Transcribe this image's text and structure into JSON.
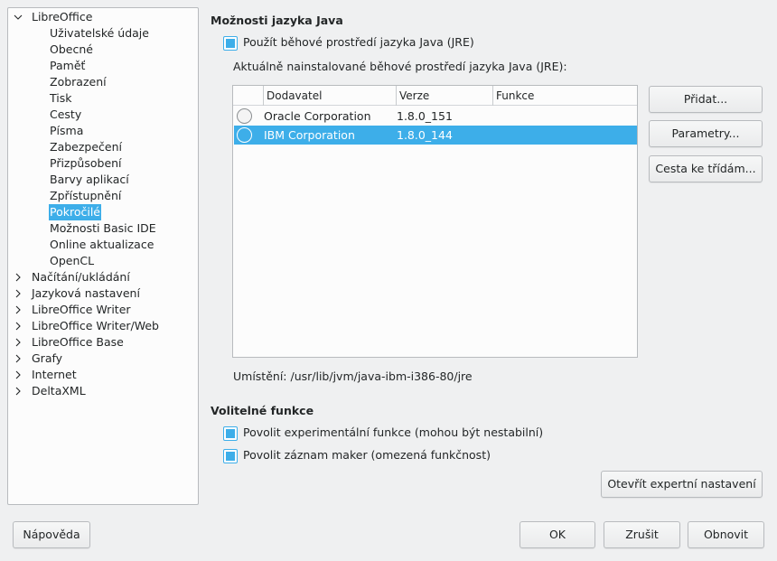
{
  "tree": {
    "root": {
      "label": "LibreOffice",
      "expanded": true
    },
    "children": [
      {
        "label": "Uživatelské údaje"
      },
      {
        "label": "Obecné"
      },
      {
        "label": "Paměť"
      },
      {
        "label": "Zobrazení"
      },
      {
        "label": "Tisk"
      },
      {
        "label": "Cesty"
      },
      {
        "label": "Písma"
      },
      {
        "label": "Zabezpečení"
      },
      {
        "label": "Přizpůsobení"
      },
      {
        "label": "Barvy aplikací"
      },
      {
        "label": "Zpřístupnění"
      },
      {
        "label": "Pokročilé",
        "selected": true
      },
      {
        "label": "Možnosti Basic IDE"
      },
      {
        "label": "Online aktualizace"
      },
      {
        "label": "OpenCL"
      }
    ],
    "collapsed": [
      {
        "label": "Načítání/ukládání"
      },
      {
        "label": "Jazyková nastavení"
      },
      {
        "label": "LibreOffice Writer"
      },
      {
        "label": "LibreOffice Writer/Web"
      },
      {
        "label": "LibreOffice Base"
      },
      {
        "label": "Grafy"
      },
      {
        "label": "Internet"
      },
      {
        "label": "DeltaXML"
      }
    ]
  },
  "java": {
    "heading": "Možnosti jazyka Java",
    "use_jre_label": "Použít běhové prostředí jazyka Java (JRE)",
    "use_jre_checked": true,
    "installed_label": "Aktuálně nainstalované běhové prostředí jazyka Java (JRE):",
    "columns": [
      "",
      "Dodavatel",
      "Verze",
      "Funkce"
    ],
    "rows": [
      {
        "vendor": "Oracle Corporation",
        "version": "1.8.0_151",
        "features": "",
        "selected": false
      },
      {
        "vendor": "IBM Corporation",
        "version": "1.8.0_144",
        "features": "",
        "selected": true
      }
    ],
    "location_label": "Umístění: /usr/lib/jvm/java-ibm-i386-80/jre",
    "buttons": {
      "add": "Přidat...",
      "parameters": "Parametry...",
      "classpath": "Cesta ke třídám..."
    }
  },
  "optional": {
    "heading": "Volitelné funkce",
    "experimental_label": "Povolit experimentální funkce (mohou být nestabilní)",
    "experimental_checked": true,
    "macro_label": "Povolit záznam maker (omezená funkčnost)",
    "macro_checked": true,
    "expert_button": "Otevřít expertní nastavení"
  },
  "footer": {
    "help": "Nápověda",
    "ok": "OK",
    "cancel": "Zrušit",
    "reset": "Obnovit"
  },
  "colors": {
    "accent": "#3daee9",
    "background": "#eff0f1",
    "panel": "#fcfcfc"
  },
  "icons": {
    "expanded": "chevron-down-icon",
    "collapsed": "chevron-right-icon"
  }
}
